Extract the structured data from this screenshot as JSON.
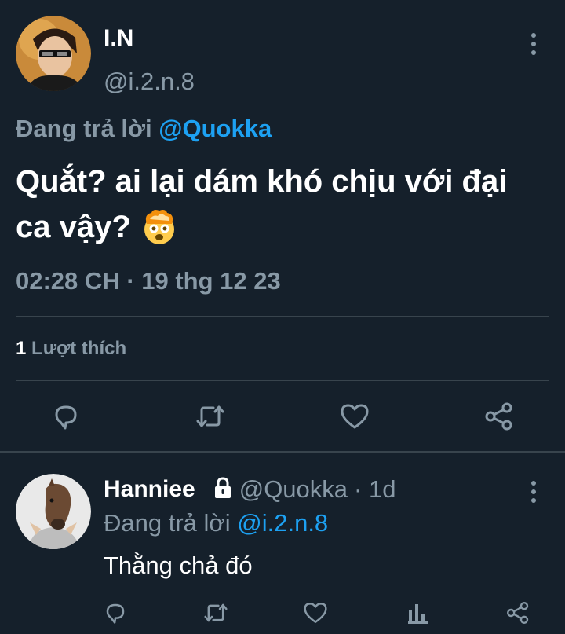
{
  "main_tweet": {
    "author_name": "I.N",
    "author_handle": "@i.2.n.8",
    "replying_prefix": "Đang trả lời",
    "replying_to": "@Quokka",
    "text_line1": "Quắt? ai lại dám khó chịu với đại",
    "text_line2": "ca vậy?",
    "emoji": "🤯",
    "time": "02:28 CH",
    "separator": "·",
    "date": "19 thg 12 23",
    "likes_count": "1",
    "likes_label": "Lượt thích"
  },
  "reply_tweet": {
    "author_name": "Hanniee",
    "author_handle": "@Quokka",
    "age": "· 1d",
    "replying_prefix": "Đang trả lời",
    "replying_to": "@i.2.n.8",
    "text": "Thằng chả đó"
  },
  "icons": {
    "action_bar": [
      "reply-icon",
      "retweet-icon",
      "like-icon",
      "share-icon"
    ],
    "reply_actions": [
      "reply-icon",
      "retweet-icon",
      "like-icon",
      "analytics-icon",
      "share-icon"
    ]
  },
  "colors": {
    "background": "#15202b",
    "accent": "#1da1f2",
    "muted": "#8899a6",
    "divider": "#38444d"
  }
}
